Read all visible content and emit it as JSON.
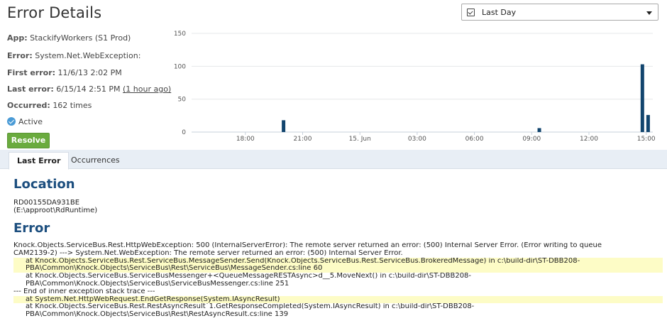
{
  "header": {
    "title": "Error Details",
    "range_label": "Last Day"
  },
  "info": {
    "app_label": "App:",
    "app_value": "StackifyWorkers (S1 Prod)",
    "error_label": "Error:",
    "error_value": "System.Net.WebException:",
    "first_label": "First error:",
    "first_value": "11/6/13 2:02 PM",
    "last_label": "Last error:",
    "last_value": "6/15/14 2:51 PM",
    "last_relative": "(1 hour ago)",
    "occurred_label": "Occurred:",
    "occurred_value": "162 times",
    "status": "Active"
  },
  "actions": {
    "resolve_label": "Resolve"
  },
  "chart_data": {
    "type": "bar",
    "y_ticks": [
      "150",
      "100",
      "50",
      "0"
    ],
    "ylim": [
      0,
      150
    ],
    "x_tick_labels": [
      "18:00",
      "21:00",
      "15. Jun",
      "03:00",
      "06:00",
      "09:00",
      "12:00",
      "15:00"
    ],
    "bar_color": "#12456e",
    "grid": true,
    "x_axis_note": "hours since 16:00 on 14 Jun",
    "bars": [
      {
        "x": 4.0,
        "value": 18
      },
      {
        "x": 17.4,
        "value": 6
      },
      {
        "x": 22.8,
        "value": 103
      },
      {
        "x": 23.1,
        "value": 26
      }
    ]
  },
  "tabs": {
    "last_error": "Last Error",
    "occurrences": "Occurrences"
  },
  "location": {
    "heading": "Location",
    "host": "RD00155DA931BE",
    "path": "(E:\\approot\\RdRuntime)"
  },
  "error": {
    "heading": "Error",
    "lines": [
      {
        "text": "Knock.Objects.ServiceBus.Rest.HttpWebException: 500 (InternalServerError): The remote server returned an error: (500) Internal Server Error. (Error writing to queue",
        "indent": false,
        "hl": false
      },
      {
        "text": "CAM2139-2) ---> System.Net.WebException: The remote server returned an error: (500) Internal Server Error.",
        "indent": false,
        "hl": false
      },
      {
        "text": "at Knock.Objects.ServiceBus.Rest.ServiceBus.MessageSender.Send(Knock.Objects.ServiceBus.Rest.ServiceBus.BrokeredMessage) in c:\\build-dir\\ST-DBB208-",
        "indent": true,
        "hl": true
      },
      {
        "text": "PBA\\Common\\Knock.Objects\\ServiceBus\\Rest\\ServiceBus\\MessageSender.cs:line 60",
        "indent": true,
        "hl": true
      },
      {
        "text": "at Knock.Objects.ServiceBus.ServiceBusMessenger+<QueueMessageRESTAsync>d__5.MoveNext() in c:\\build-dir\\ST-DBB208-",
        "indent": true,
        "hl": false
      },
      {
        "text": "PBA\\Common\\Knock.Objects\\ServiceBus\\ServiceBusMessenger.cs:line 251",
        "indent": true,
        "hl": false
      },
      {
        "text": "--- End of inner exception stack trace ---",
        "indent": false,
        "hl": false
      },
      {
        "text": "at System.Net.HttpWebRequest.EndGetResponse(System.IAsyncResult)",
        "indent": true,
        "hl": true
      },
      {
        "text": "at Knock.Objects.ServiceBus.Rest.RestAsyncResult`1.GetResponseCompleted(System.IAsyncResult) in c:\\build-dir\\ST-DBB208-",
        "indent": true,
        "hl": false
      },
      {
        "text": "PBA\\Common\\Knock.Objects\\ServiceBus\\Rest\\RestAsyncResult.cs:line 139",
        "indent": true,
        "hl": false
      }
    ]
  }
}
